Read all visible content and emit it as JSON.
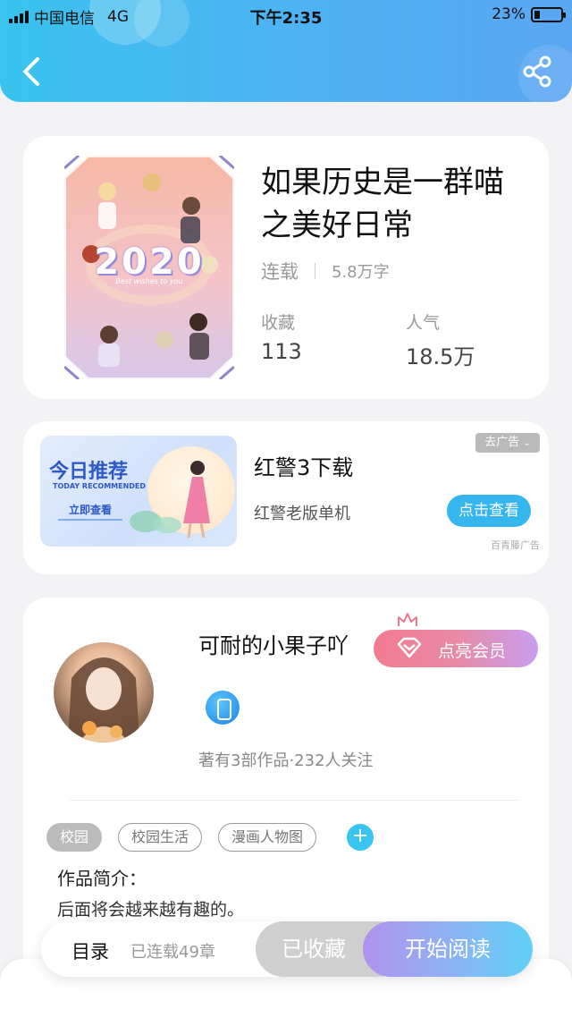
{
  "status_bar": {
    "carrier": "中国电信",
    "network": "4G",
    "time": "下午2:35",
    "battery_percent": "23%",
    "battery_level": 0.23
  },
  "nav": {
    "back_icon": "chevron-left-icon",
    "share_icon": "share-icon"
  },
  "book": {
    "title_line1": "如果历史是一群喵",
    "title_line2": "之美好日常",
    "status": "连载",
    "word_count": "5.8万字",
    "collect_label": "收藏",
    "collect_value": "113",
    "popularity_label": "人气",
    "popularity_value": "18.5万",
    "cover": {
      "year": "2020",
      "subtitle": "Best wishes to you"
    }
  },
  "ad": {
    "banner": {
      "title": "今日推荐",
      "subtitle": "TODAY RECOMMENDED",
      "cta": "立即查看"
    },
    "title": "红警3下载",
    "description": "红警老版单机",
    "button": "点击查看",
    "close_label": "去广告",
    "source": "百青藤广告"
  },
  "author": {
    "name": "可耐的小果子吖",
    "vip_button": "点亮会员",
    "meta": "著有3部作品·232人关注"
  },
  "tags": [
    "校园",
    "校园生活",
    "漫画人物图"
  ],
  "intro": {
    "label": "作品简介：",
    "text": "后面将会越来越有趣的。"
  },
  "bottom_bar": {
    "toc": "目录",
    "chapters": "已连载49章",
    "collected": "已收藏",
    "start_reading": "开始阅读"
  },
  "colors": {
    "header_gradient": [
      "#39c3ee",
      "#5aa6f2"
    ],
    "accent_blue": "#35b6ee",
    "vip_gradient": [
      "#f27a90",
      "#c89ef0"
    ],
    "read_gradient": [
      "#b192ee",
      "#5fd1f5"
    ]
  }
}
